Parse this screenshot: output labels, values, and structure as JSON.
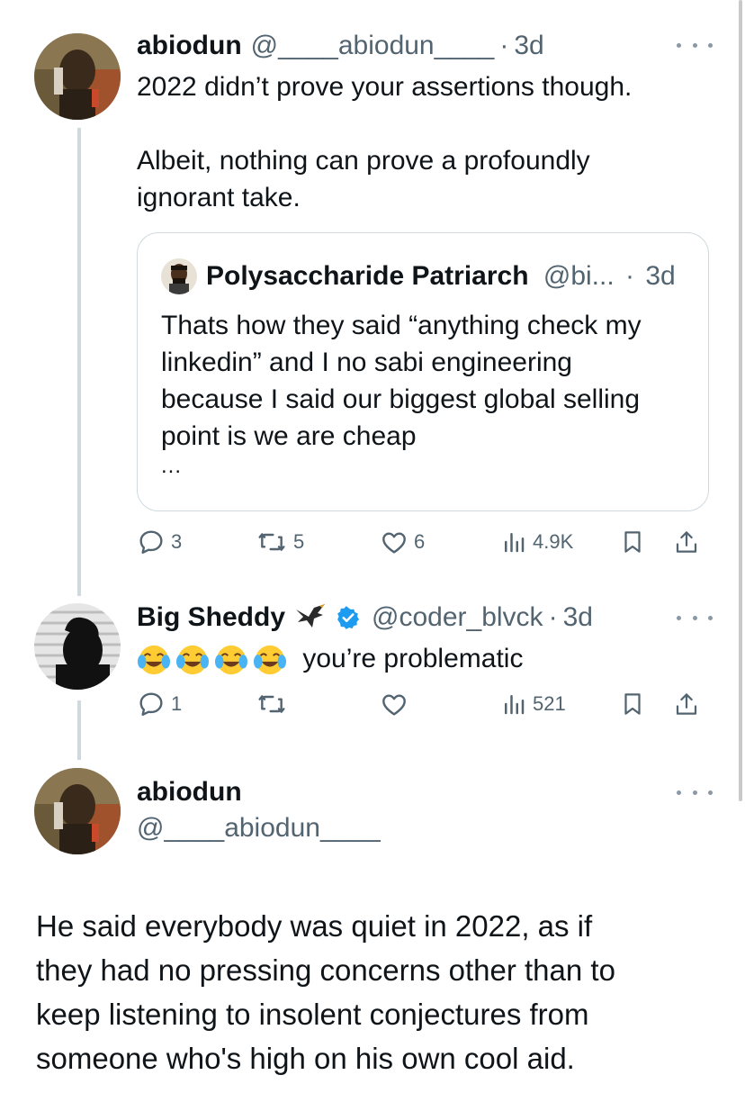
{
  "tweet1": {
    "name": "abiodun",
    "handle": "@____abiodun____",
    "dot": "·",
    "time": "3d",
    "text_line1": "2022 didn’t prove your assertions though.",
    "text_line2": "Albeit, nothing can prove a profoundly",
    "text_line3": "ignorant take.",
    "quote": {
      "name": "Polysaccharide Patriarch",
      "handle": "@bi...",
      "dot": "·",
      "time": "3d",
      "line1": "Thats how they said “anything check my",
      "line2": "linkedin” and I no sabi engineering",
      "line3": "because I said our biggest global selling",
      "line4": "point is we are cheap",
      "ellipsis": "..."
    },
    "actions": {
      "replies": "3",
      "reposts": "5",
      "likes": "6",
      "views": "4.9K"
    }
  },
  "tweet2": {
    "name": "Big Sheddy",
    "handle": "@coder_blvck",
    "dot": "·",
    "time": "3d",
    "text": "you’re problematic",
    "emoji_icon": "tears-of-joy-emoji",
    "actions": {
      "replies": "1",
      "reposts": "",
      "likes": "",
      "views": "521"
    }
  },
  "main_tweet": {
    "name": "abiodun",
    "handle": "@____abiodun____",
    "line1": "He said everybody was quiet in 2022, as if",
    "line2": "they had no pressing concerns other than to",
    "line3": "keep listening to insolent conjectures from",
    "line4": "someone who's high on his own cool aid."
  },
  "colors": {
    "text": "#0f1419",
    "secondary": "#536471",
    "border": "#cfd9de",
    "verified": "#1d9bf0"
  }
}
